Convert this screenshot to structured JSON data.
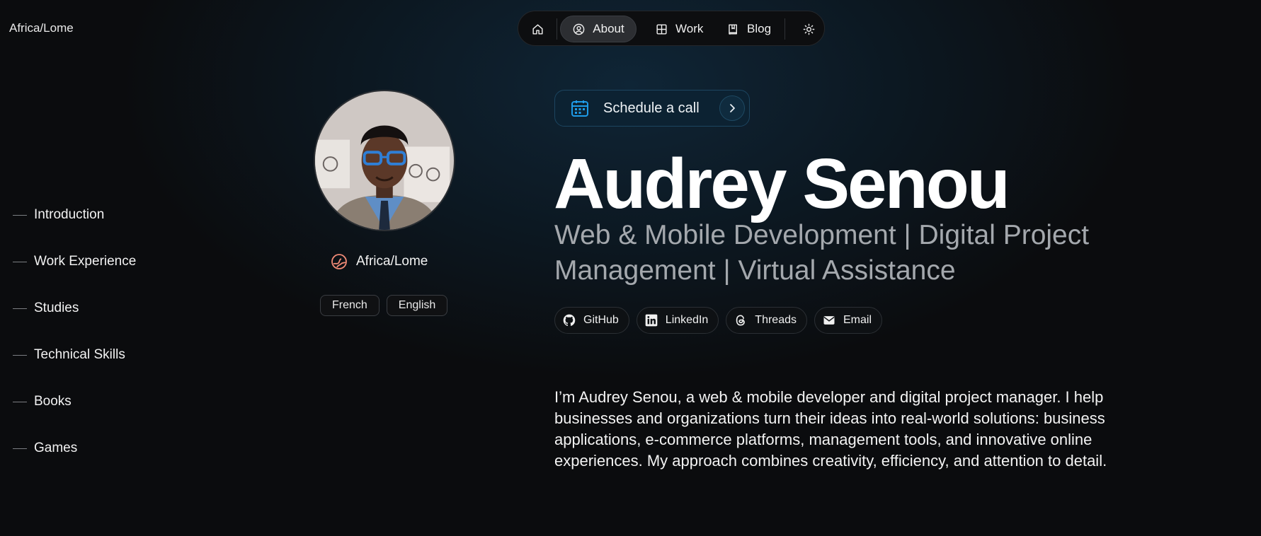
{
  "header": {
    "location": "Africa/Lome"
  },
  "nav": {
    "items": [
      {
        "icon": "home-icon",
        "label": ""
      },
      {
        "icon": "person-circle-icon",
        "label": "About",
        "active": true
      },
      {
        "icon": "grid-icon",
        "label": "Work"
      },
      {
        "icon": "book-icon",
        "label": "Blog"
      },
      {
        "icon": "sun-icon",
        "label": ""
      }
    ]
  },
  "toc": {
    "items": [
      "Introduction",
      "Work Experience",
      "Studies",
      "Technical Skills",
      "Books",
      "Games"
    ]
  },
  "profile": {
    "location": "Africa/Lome",
    "languages": [
      "French",
      "English"
    ]
  },
  "cta": {
    "label": "Schedule a call",
    "icon": "calendar-icon",
    "accent": "#1e9be8"
  },
  "hero": {
    "name": "Audrey Senou",
    "headline": "Web & Mobile Development | Digital Project Management | Virtual Assistance"
  },
  "socials": [
    {
      "label": "GitHub",
      "icon": "github-icon"
    },
    {
      "label": "LinkedIn",
      "icon": "linkedin-icon"
    },
    {
      "label": "Threads",
      "icon": "threads-icon"
    },
    {
      "label": "Email",
      "icon": "email-icon"
    }
  ],
  "bio": "I’m Audrey Senou, a web & mobile developer and digital project manager. I help businesses and organizations turn their ideas into real-world solutions: business applications, e-commerce platforms, management tools, and innovative online experiences. My approach combines creativity, efficiency, and attention to detail."
}
